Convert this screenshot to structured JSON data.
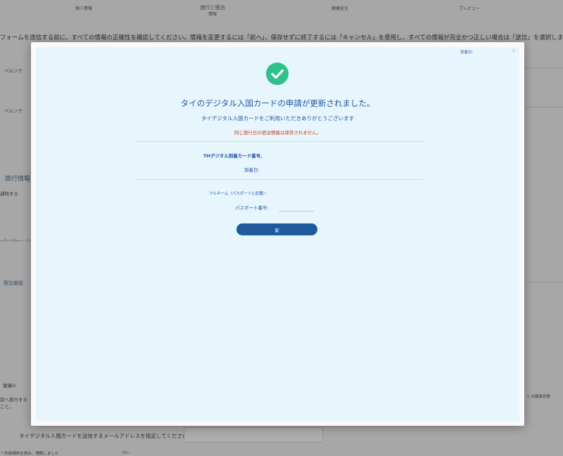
{
  "background": {
    "steps": [
      {
        "label": "個人情報",
        "sub": ""
      },
      {
        "label": "旅行と宿泊",
        "sub": "情報"
      },
      {
        "label": "健康宣言",
        "sub": ""
      },
      {
        "label": "プレビュー",
        "sub": ""
      }
    ],
    "intro": "フォームを送信する前に、すべての情報の正確性を確認してください。情報を変更するには「前へ」、保存せずに終了するには「キャンセル」を使用し、すべての情報が完全かつ正しい場合は「送信」を選択します。",
    "persona_1": "ペルソナ",
    "persona_2": "ペルソナ",
    "travel_info": "旅行情報",
    "notify": "通知する",
    "boarding": "ーパートチャー・インベ",
    "accommodation": "宿泊施設",
    "health": "健康D",
    "health_sub_1": "前へ旅行する",
    "health_sub_2": "こと。",
    "health_note": "< の健康状態",
    "email_label": "タイデジタル入国カードを送信するメールアドレスを指定してください",
    "terms": "* 利用規約を読み、理解しました",
    "terms_red": "-tin-"
  },
  "modal": {
    "arrival_top": "到着日:",
    "close_icon": "×",
    "title": "タイのデジタル入国カードの申請が更新されました。",
    "thanks": "タイデジタル入国カードをご利用いただきありがとうございます",
    "warning": "同じ旅行日の宿泊情報は保存されません。",
    "card_number_label": "THデジタル到着カード番号、",
    "arrival_date_label": "到着日:",
    "fullname_label": "フルネーム（パスポートに記載）：",
    "passport_label": "パスポート番号:",
    "ok_button": "家"
  },
  "colors": {
    "accent": "#2255a8",
    "success": "#2fc18c",
    "warning": "#d03a1a",
    "button": "#1d5a9e"
  }
}
